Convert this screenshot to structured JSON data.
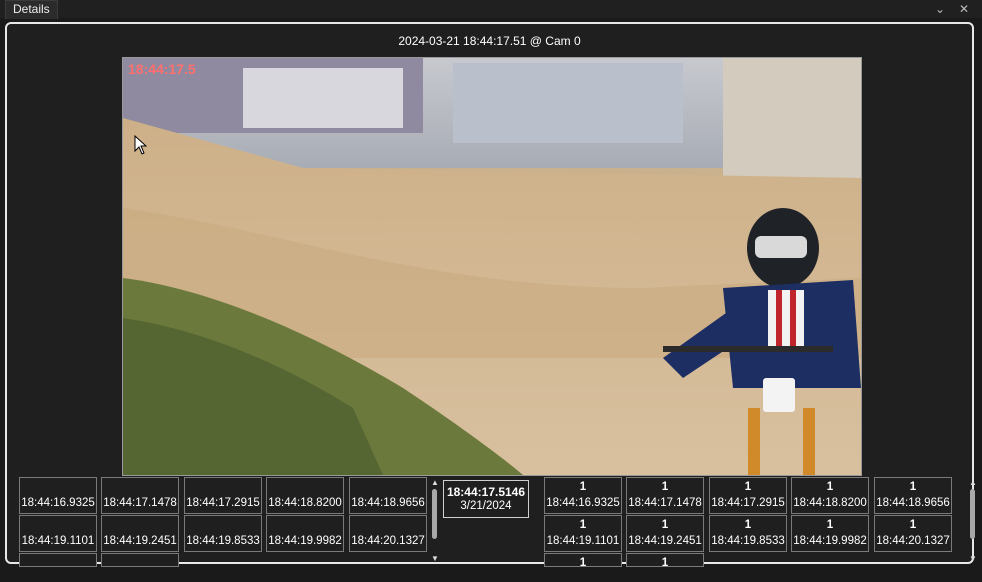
{
  "tab": {
    "title": "Details"
  },
  "window_controls": {
    "collapse": "⌄",
    "close": "✕"
  },
  "header": {
    "caption": "2024-03-21 18:44:17.51 @ Cam 0"
  },
  "frame": {
    "overlay_time": "18:44:17.5"
  },
  "left_thumbs": [
    {
      "ts": "18:44:16.9325"
    },
    {
      "ts": "18:44:17.1478"
    },
    {
      "ts": "18:44:17.2915"
    },
    {
      "ts": "18:44:18.8200"
    },
    {
      "ts": "18:44:18.9656"
    },
    {
      "ts": "18:44:19.1101"
    },
    {
      "ts": "18:44:19.2451"
    },
    {
      "ts": "18:44:19.8533"
    },
    {
      "ts": "18:44:19.9982"
    },
    {
      "ts": "18:44:20.1327"
    }
  ],
  "center": {
    "time": "18:44:17.5146",
    "date": "3/21/2024"
  },
  "right_thumbs": [
    {
      "count": "1",
      "ts": "18:44:16.9325"
    },
    {
      "count": "1",
      "ts": "18:44:17.1478"
    },
    {
      "count": "1",
      "ts": "18:44:17.2915"
    },
    {
      "count": "1",
      "ts": "18:44:18.8200"
    },
    {
      "count": "1",
      "ts": "18:44:18.9656"
    },
    {
      "count": "1",
      "ts": "18:44:19.1101"
    },
    {
      "count": "1",
      "ts": "18:44:19.2451"
    },
    {
      "count": "1",
      "ts": "18:44:19.8533"
    },
    {
      "count": "1",
      "ts": "18:44:19.9982"
    },
    {
      "count": "1",
      "ts": "18:44:20.1327"
    }
  ],
  "partial_row": {
    "left_visible": 2,
    "right_visible": 2,
    "right_count": "1"
  },
  "colors": {
    "overlay": "#ff6f6f",
    "panel_border": "#e8e8e8",
    "background": "#1a1a1a"
  },
  "icons": {
    "collapse": "chevron-down-icon",
    "close": "close-icon",
    "cursor": "mouse-cursor-icon"
  }
}
